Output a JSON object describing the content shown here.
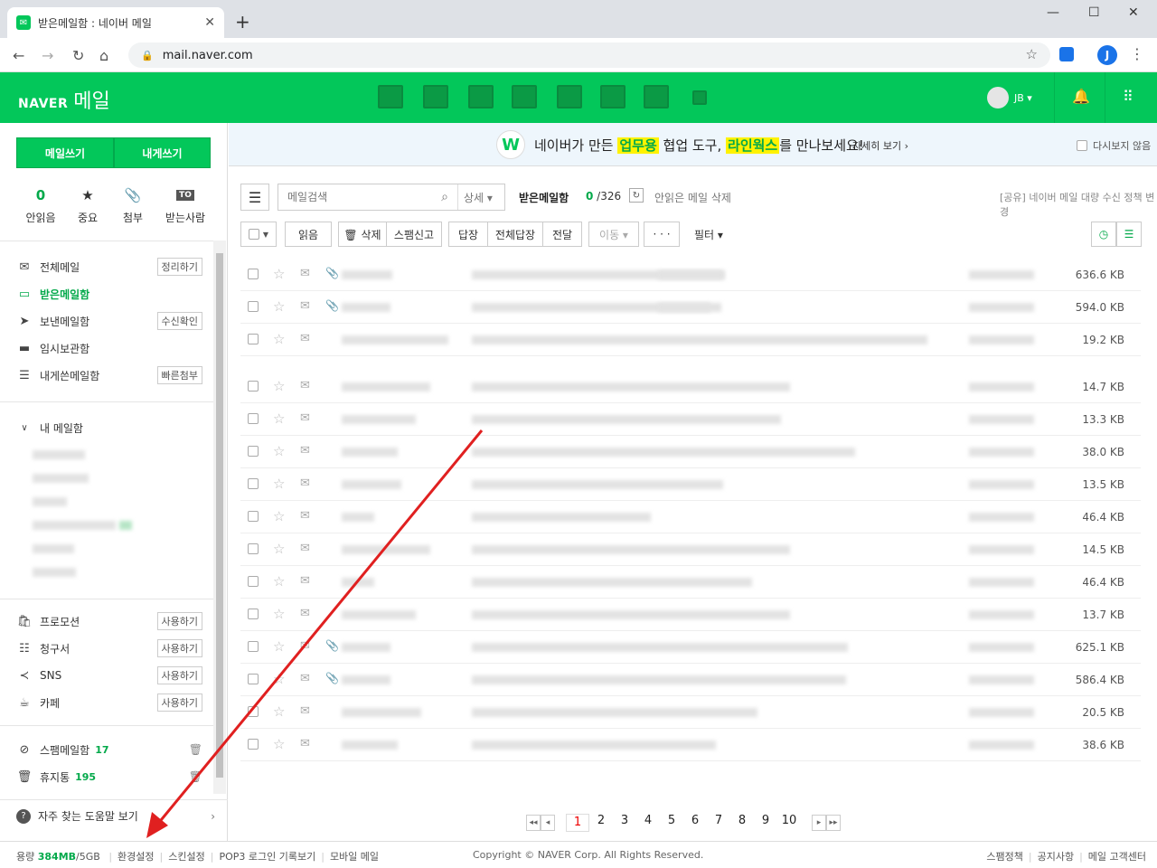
{
  "browser": {
    "tab_title": "받은메일함 : 네이버 메일",
    "new_tab": "+",
    "url": "mail.naver.com",
    "profile_initial": "J"
  },
  "header": {
    "logo_naver": "NAVER",
    "logo_mail": "메일",
    "user": "JB ▾",
    "services": [
      "mail-home",
      "calendar",
      "contacts-list",
      "address-book",
      "cloud",
      "memo",
      "money",
      "more"
    ]
  },
  "sidebar": {
    "write_label": "메일쓰기",
    "self_write_label": "내게쓰기",
    "quick": [
      {
        "top": "0",
        "label": "안읽음"
      },
      {
        "top": "★",
        "label": "중요"
      },
      {
        "top": "📎",
        "label": "첨부"
      },
      {
        "top": "TO",
        "label": "받는사람"
      }
    ],
    "folders": [
      {
        "label": "전체메일",
        "tag": "정리하기",
        "icon": "mail-icon"
      },
      {
        "label": "받은메일함",
        "tag": "",
        "icon": "inbox-icon"
      },
      {
        "label": "보낸메일함",
        "tag": "수신확인",
        "icon": "send-icon"
      },
      {
        "label": "임시보관함",
        "tag": "",
        "icon": "folder-icon"
      },
      {
        "label": "내게쓴메일함",
        "tag": "빠른첨부",
        "icon": "note-icon"
      }
    ],
    "my_mailbox_label": "내 메일함",
    "smart": [
      {
        "label": "프로모션",
        "tag": "사용하기"
      },
      {
        "label": "청구서",
        "tag": "사용하기"
      },
      {
        "label": "SNS",
        "tag": "사용하기"
      },
      {
        "label": "카페",
        "tag": "사용하기"
      }
    ],
    "spam": {
      "label": "스팸메일함",
      "count": "17"
    },
    "trash": {
      "label": "휴지통",
      "count": "195"
    },
    "help_label": "자주 찾는 도움말 보기",
    "help_chevron": "›"
  },
  "banner": {
    "pre": "네이버가 만든 ",
    "hl1": "업무용",
    "mid": " 협업 도구, ",
    "hl2": "라인웍스",
    "post": "를 만나보세요!",
    "more": "자세히 보기 ›",
    "no_show": "다시보지 않음",
    "logo": "W"
  },
  "toolbar": {
    "search_placeholder": "메일검색",
    "advanced": "상세 ▾",
    "mailbox": "받은메일함",
    "unread": "0",
    "total": " /326",
    "delete_unread": "안읽은 메일 삭제",
    "policy": "[공유] 네이버 메일 대량 수신 정책 변경",
    "read": "읽음",
    "delete": "🗑 삭제",
    "spam": "스팸신고",
    "reply": "답장",
    "reply_all": "전체답장",
    "forward": "전달",
    "move": "이동 ▾",
    "more": "· · ·",
    "filter": "필터 ▾"
  },
  "mails": [
    {
      "size": "636.6 KB",
      "attach": true
    },
    {
      "size": "594.0 KB",
      "attach": true
    },
    {
      "size": "19.2 KB",
      "attach": false
    },
    {
      "size": "14.7 KB",
      "attach": false
    },
    {
      "size": "13.3 KB",
      "attach": false
    },
    {
      "size": "38.0 KB",
      "attach": false
    },
    {
      "size": "13.5 KB",
      "attach": false
    },
    {
      "size": "46.4 KB",
      "attach": false
    },
    {
      "size": "14.5 KB",
      "attach": false
    },
    {
      "size": "46.4 KB",
      "attach": false
    },
    {
      "size": "13.7 KB",
      "attach": false
    },
    {
      "size": "625.1 KB",
      "attach": true
    },
    {
      "size": "586.4 KB",
      "attach": true
    },
    {
      "size": "20.5 KB",
      "attach": false
    },
    {
      "size": "38.6 KB",
      "attach": false
    }
  ],
  "pager": {
    "pages": [
      "1",
      "2",
      "3",
      "4",
      "5",
      "6",
      "7",
      "8",
      "9",
      "10"
    ],
    "current": "1"
  },
  "footer": {
    "usage_label": "용량",
    "usage_value": "384MB",
    "usage_total": "/5GB",
    "links_left": [
      "환경설정",
      "스킨설정",
      "POP3 로그인 기록보기",
      "모바일 메일"
    ],
    "copyright": "Copyright © NAVER Corp. All Rights Reserved.",
    "links_right": [
      "스팸정책",
      "공지사항",
      "메일 고객센터"
    ]
  },
  "colors": {
    "brand": "#03c75a",
    "annotation": "#e02020"
  }
}
